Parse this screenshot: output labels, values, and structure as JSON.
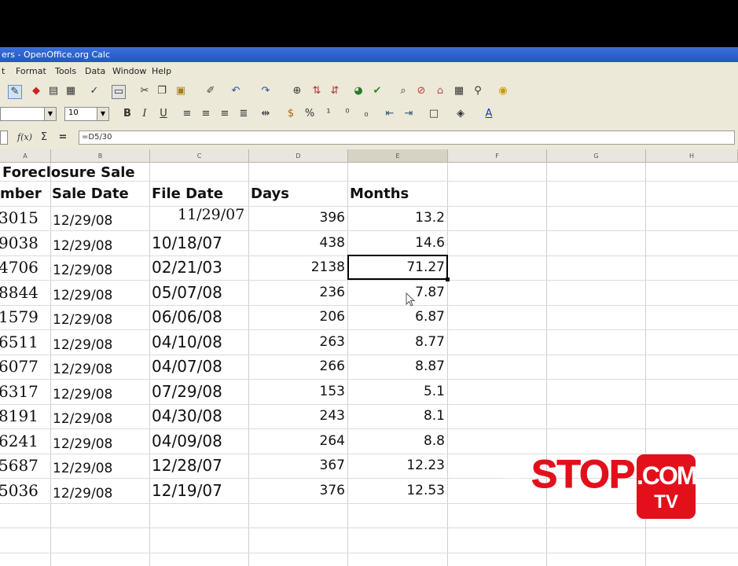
{
  "window": {
    "title": "ers - OpenOffice.org Calc"
  },
  "menu": {
    "items": [
      "t",
      "Format",
      "Tools",
      "Data",
      "Window",
      "Help"
    ]
  },
  "toolbar": {
    "font_size": "10"
  },
  "formula": {
    "cell_value": "=D5/30"
  },
  "columns": [
    "A",
    "B",
    "C",
    "D",
    "E",
    "F",
    "G",
    "H"
  ],
  "sheet": {
    "title": "Foreclosure Sale",
    "headers": {
      "number": "mber",
      "sale_date": "Sale Date",
      "file_date": "File Date",
      "days": "Days",
      "months": "Months"
    },
    "rows": [
      {
        "number": "3015",
        "sale_date": "12/29/08",
        "file_date": "11/29/07",
        "days": "396",
        "months": "13.2"
      },
      {
        "number": "9038",
        "sale_date": "12/29/08",
        "file_date": "10/18/07",
        "days": "438",
        "months": "14.6"
      },
      {
        "number": "4706",
        "sale_date": "12/29/08",
        "file_date": "02/21/03",
        "days": "2138",
        "months": "71.27"
      },
      {
        "number": "8844",
        "sale_date": "12/29/08",
        "file_date": "05/07/08",
        "days": "236",
        "months": "7.87"
      },
      {
        "number": "1579",
        "sale_date": "12/29/08",
        "file_date": "06/06/08",
        "days": "206",
        "months": "6.87"
      },
      {
        "number": "6511",
        "sale_date": "12/29/08",
        "file_date": "04/10/08",
        "days": "263",
        "months": "8.77"
      },
      {
        "number": "6077",
        "sale_date": "12/29/08",
        "file_date": "04/07/08",
        "days": "266",
        "months": "8.87"
      },
      {
        "number": "6317",
        "sale_date": "12/29/08",
        "file_date": "07/29/08",
        "days": "153",
        "months": "5.1"
      },
      {
        "number": "8191",
        "sale_date": "12/29/08",
        "file_date": "04/30/08",
        "days": "243",
        "months": "8.1"
      },
      {
        "number": "6241",
        "sale_date": "12/29/08",
        "file_date": "04/09/08",
        "days": "264",
        "months": "8.8"
      },
      {
        "number": "5687",
        "sale_date": "12/29/08",
        "file_date": "12/28/07",
        "days": "367",
        "months": "12.23"
      },
      {
        "number": "5036",
        "sale_date": "12/29/08",
        "file_date": "12/19/07",
        "days": "376",
        "months": "12.53"
      }
    ]
  },
  "logo": {
    "stop": "STOP",
    "com": ".COM",
    "tv": "TV"
  },
  "colors": {
    "title_bar": "#2456c4",
    "logo_red": "#e3101b",
    "chrome": "#ece9d8"
  }
}
